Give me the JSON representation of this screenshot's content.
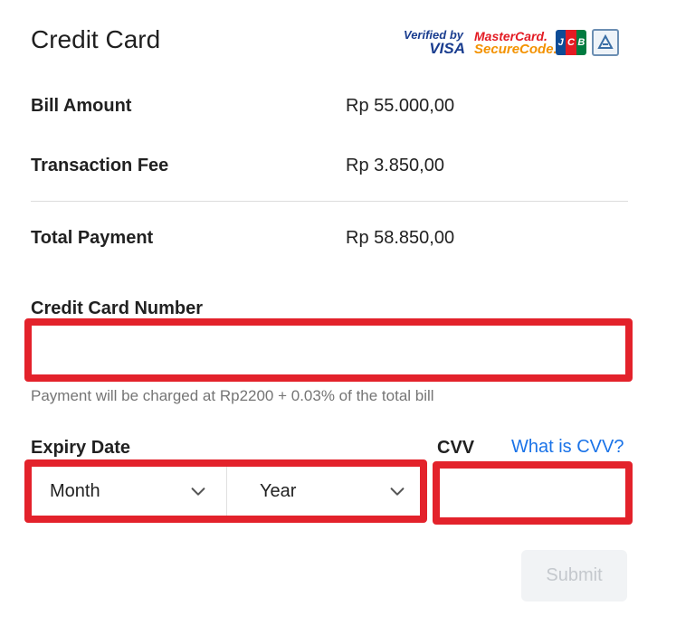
{
  "header": {
    "title": "Credit Card",
    "logos": {
      "visa_line1": "Verified by",
      "visa_line2": "VISA",
      "mc_line1": "MasterCard.",
      "mc_line2": "SecureCode.",
      "jcb": [
        "J",
        "C",
        "B"
      ],
      "jcb_colors": [
        "#0e4c96",
        "#e31b23",
        "#007b40"
      ],
      "amex_icon": "safekey-icon"
    }
  },
  "summary": {
    "bill_amount": {
      "label": "Bill Amount",
      "value": "Rp 55.000,00"
    },
    "transaction_fee": {
      "label": "Transaction Fee",
      "value": "Rp 3.850,00"
    },
    "total_payment": {
      "label": "Total Payment",
      "value": "Rp 58.850,00"
    }
  },
  "form": {
    "card_number": {
      "label": "Credit Card Number",
      "value": "",
      "placeholder": "",
      "hint": "Payment will be charged at Rp2200 + 0.03% of the total bill"
    },
    "expiry": {
      "label": "Expiry Date",
      "month": "Month",
      "year": "Year"
    },
    "cvv": {
      "label": "CVV",
      "help_link": "What is CVV?",
      "value": ""
    },
    "submit_label": "Submit"
  },
  "colors": {
    "highlight": "#e3222b",
    "link": "#1a73e8",
    "submit_bg": "#f1f3f5",
    "submit_text": "#c4c8cd"
  }
}
